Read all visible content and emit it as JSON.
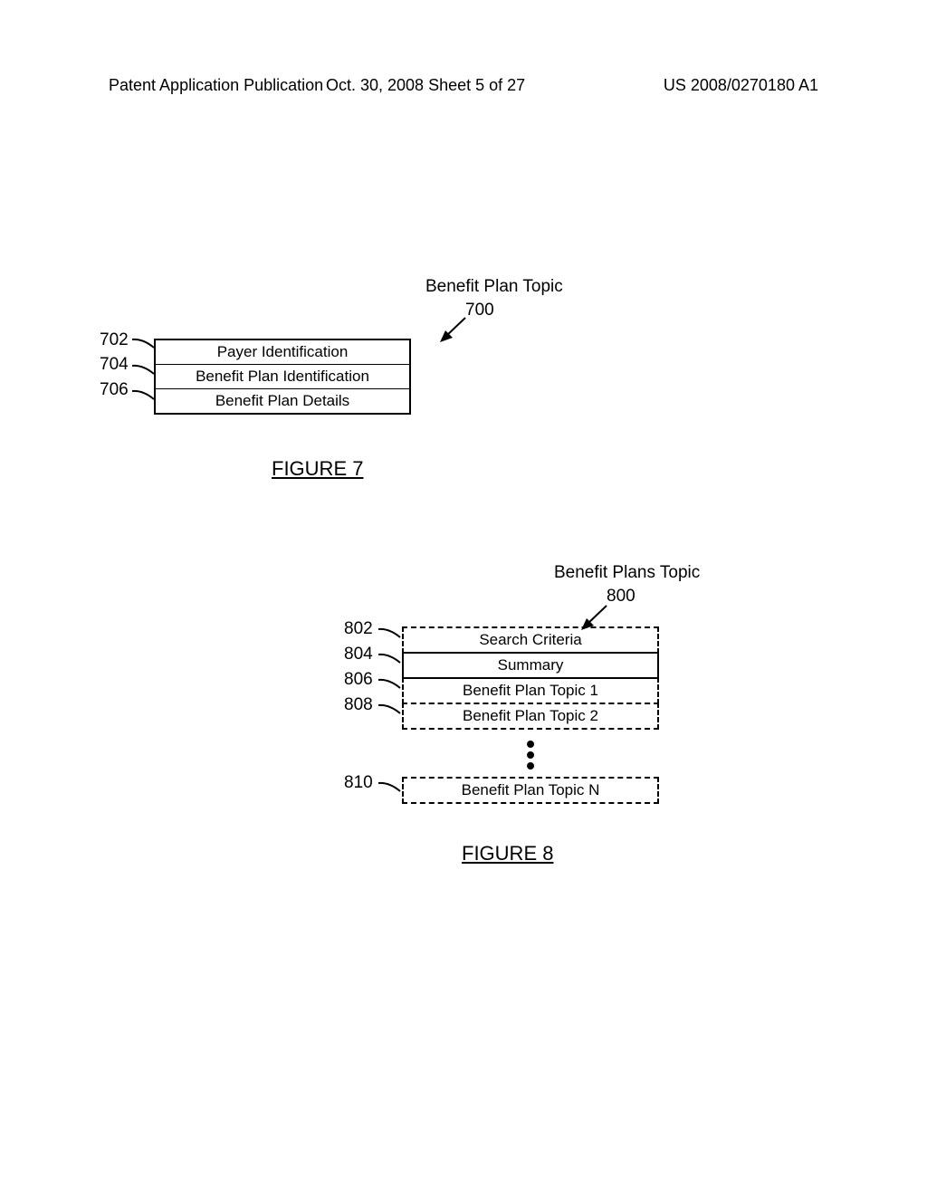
{
  "header": {
    "left": "Patent Application Publication",
    "mid": "Oct. 30, 2008  Sheet 5 of 27",
    "right": "US 2008/0270180 A1"
  },
  "figure7": {
    "title": "Benefit Plan Topic",
    "ref": "700",
    "rows": [
      "Payer Identification",
      "Benefit Plan Identification",
      "Benefit Plan Details"
    ],
    "labels": {
      "r702": "702",
      "r704": "704",
      "r706": "706"
    },
    "caption": "FIGURE 7"
  },
  "figure8": {
    "title": "Benefit Plans Topic",
    "ref": "800",
    "rows": {
      "r1": "Search Criteria",
      "r2": "Summary",
      "r3": "Benefit Plan Topic 1",
      "r4": "Benefit Plan Topic 2",
      "rn": "Benefit Plan Topic N"
    },
    "labels": {
      "r802": "802",
      "r804": "804",
      "r806": "806",
      "r808": "808",
      "r810": "810"
    },
    "caption": "FIGURE 8"
  }
}
